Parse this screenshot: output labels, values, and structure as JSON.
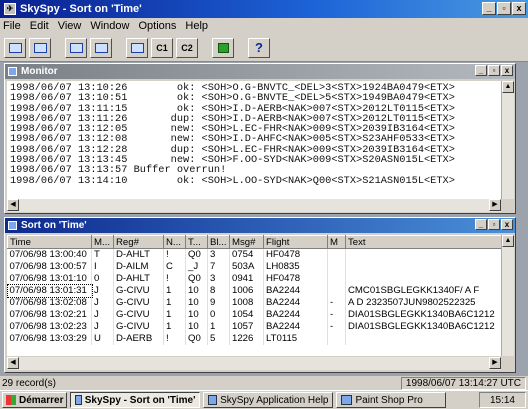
{
  "app": {
    "title": "SkySpy - Sort on 'Time'"
  },
  "menu": [
    "File",
    "Edit",
    "View",
    "Window",
    "Options",
    "Help"
  ],
  "toolbar": {
    "c1": "C1",
    "c2": "C2",
    "help": "?"
  },
  "monitor": {
    "title": "Monitor",
    "lines": [
      "1998/06/07 13:10:26        ok: <SOH>O.G-BNVTC_<DEL>3<STX>1924BA0479<ETX>",
      "1998/06/07 13:10:51        ok: <SOH>O.G-BNVTE_<DEL>5<STX>1949BA0479<ETX>",
      "1998/06/07 13:11:15        ok: <SOH>I.D-AERB<NAK>007<STX>2012LT0115<ETX>",
      "1998/06/07 13:11:26       dup: <SOH>I.D-AERB<NAK>007<STX>2012LT0115<ETX>",
      "1998/06/07 13:12:05       new: <SOH>L.EC-FHR<NAK>009<STX>2039IB3164<ETX>",
      "1998/06/07 13:12:08       new: <SOH>I.D-AHFC<NAK>005<STX>S23AHF0533<ETX>",
      "1998/06/07 13:12:28       dup: <SOH>L.EC-FHR<NAK>009<STX>2039IB3164<ETX>",
      "1998/06/07 13:13:45       new: <SOH>F.OO-SYD<NAK>009<STX>S20ASN015L<ETX>",
      "1998/06/07 13:13:57 Buffer overrun!",
      "1998/06/07 13:14:10        ok: <SOH>L.OO-SYD<NAK>Q00<STX>S21ASN015L<ETX>"
    ]
  },
  "sortwin": {
    "title": "Sort on 'Time'",
    "columns": [
      "Time",
      "M...",
      "Reg#",
      "N...",
      "T...",
      "Bl...",
      "Msg#",
      "Flight",
      "M",
      "Text"
    ],
    "rows": [
      [
        "07/06/98 13:00:40",
        "T",
        "D-AHLT",
        "!",
        "Q0",
        "3",
        "0754",
        "HF0478",
        "",
        ""
      ],
      [
        "07/06/98 13:00:57",
        "I",
        "D-AILM",
        "C",
        "_J",
        "7",
        "503A",
        "LH0835",
        "",
        ""
      ],
      [
        "07/06/98 13:01:10",
        "0",
        "D-AHLT",
        "!",
        "Q0",
        "3",
        "0941",
        "HF0478",
        "",
        ""
      ],
      [
        "07/06/98 13:01:31",
        "J",
        "G-CIVU",
        "1",
        "10",
        "8",
        "1006",
        "BA2244",
        "",
        "CMC01SBGLEGKK1340F/ A F"
      ],
      [
        "07/06/98 13:02:08",
        "J",
        "G-CIVU",
        "1",
        "10",
        "9",
        "1008",
        "BA2244",
        "-",
        "A D 2323507JUN9802522325"
      ],
      [
        "07/06/98 13:02:21",
        "J",
        "G-CIVU",
        "1",
        "10",
        "0",
        "1054",
        "BA2244",
        "-",
        "DIA01SBGLEGKK1340BA6C1212"
      ],
      [
        "07/06/98 13:02:23",
        "J",
        "G-CIVU",
        "1",
        "10",
        "1",
        "1057",
        "BA2244",
        "-",
        "DIA01SBGLEGKK1340BA6C1212"
      ],
      [
        "07/06/98 13:03:29",
        "U",
        "D-AERB",
        "!",
        "Q0",
        "5",
        "1226",
        "LT0115",
        "",
        ""
      ]
    ]
  },
  "status": {
    "records": "29 record(s)",
    "datetime": "1998/06/07  13:14:27 UTC"
  },
  "taskbar": {
    "start": "Démarrer",
    "t1": "SkySpy - Sort on 'Time'",
    "t2": "SkySpy Application Help",
    "t3": "Paint Shop Pro",
    "clock": "15:14"
  }
}
